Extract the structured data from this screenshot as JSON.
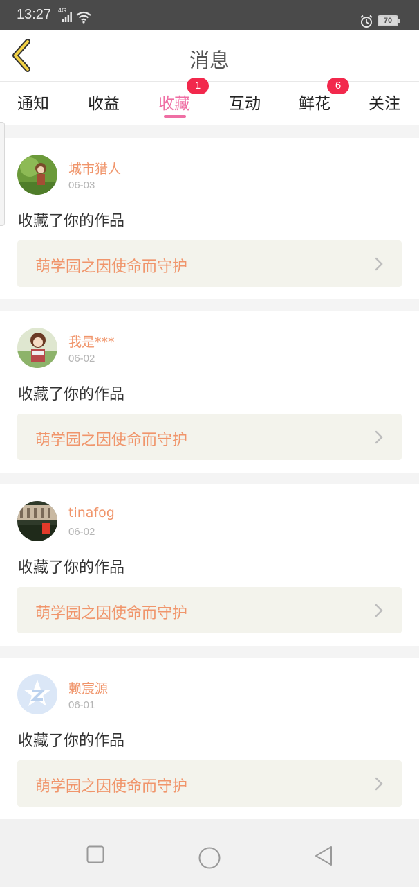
{
  "status": {
    "time": "13:27",
    "network": "4G",
    "battery": "70"
  },
  "header": {
    "title": "消息"
  },
  "tabs": [
    {
      "label": "通知"
    },
    {
      "label": "收益"
    },
    {
      "label": "收藏",
      "badge": "1",
      "active": true
    },
    {
      "label": "互动"
    },
    {
      "label": "鲜花",
      "badge": "6"
    },
    {
      "label": "关注"
    }
  ],
  "items": [
    {
      "user": "城市猎人",
      "date": "06-03",
      "action": "收藏了你的作品",
      "work": "萌学园之因使命而守护"
    },
    {
      "user": "我是***",
      "date": "06-02",
      "action": "收藏了你的作品",
      "work": "萌学园之因使命而守护"
    },
    {
      "user": "tinafog",
      "date": "06-02",
      "action": "收藏了你的作品",
      "work": "萌学园之因使命而守护"
    },
    {
      "user": "赖宸源",
      "date": "06-01",
      "action": "收藏了你的作品",
      "work": "萌学园之因使命而守护"
    }
  ],
  "icons": {
    "back": "chevron-left-icon",
    "row_arrow": "chevron-right-icon",
    "nav": [
      "square-recent-icon",
      "circle-home-icon",
      "triangle-back-icon"
    ]
  },
  "colors": {
    "accent_pink": "#ef6fa4",
    "badge_red": "#f2284c",
    "name_orange": "#f0956b"
  }
}
